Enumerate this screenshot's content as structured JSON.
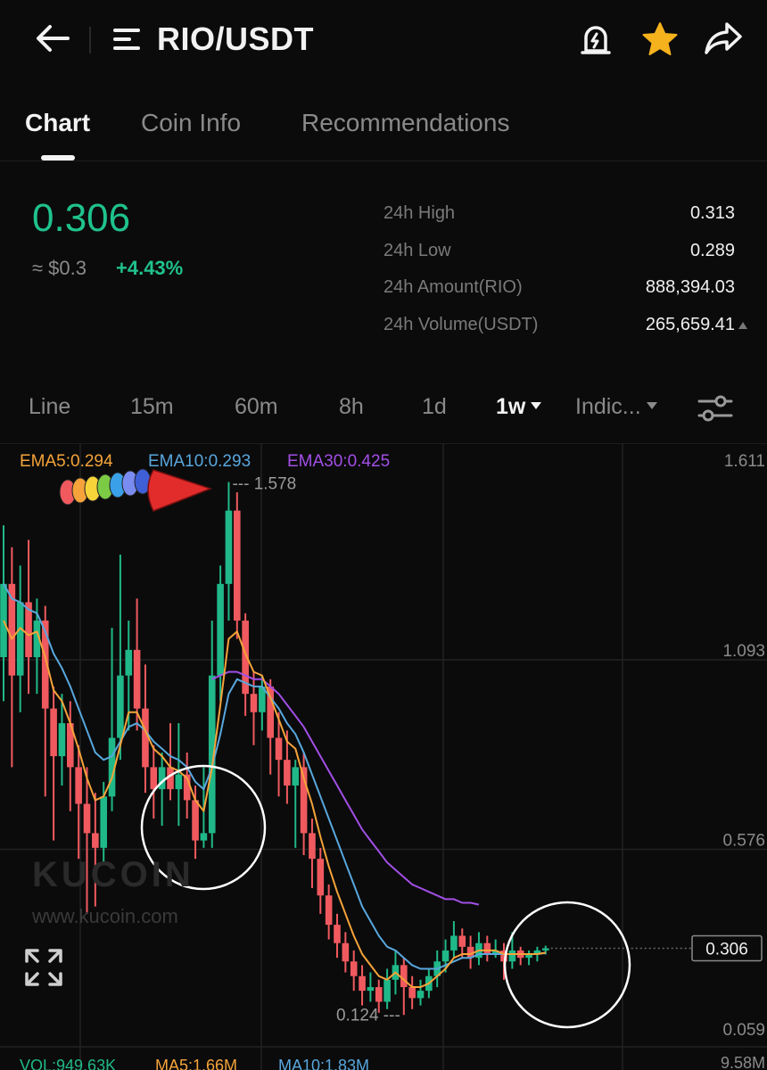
{
  "header": {
    "title": "RIO/USDT"
  },
  "tabs": [
    {
      "label": "Chart",
      "active": true
    },
    {
      "label": "Coin Info",
      "active": false
    },
    {
      "label": "Recommendations",
      "active": false
    }
  ],
  "ticker": {
    "price": "0.306",
    "fiat": "≈ $0.3",
    "change": "+4.43%",
    "stats": [
      {
        "label": "24h High",
        "value": "0.313"
      },
      {
        "label": "24h Low",
        "value": "0.289"
      },
      {
        "label": "24h Amount(RIO)",
        "value": "888,394.03"
      },
      {
        "label": "24h Volume(USDT)",
        "value": "265,659.41"
      }
    ]
  },
  "intervals": [
    "Line",
    "15m",
    "60m",
    "8h",
    "1d",
    "1w",
    "Indic..."
  ],
  "active_interval": "1w",
  "chart": {
    "legend": {
      "ema5": "EMA5:0.294",
      "ema10": "EMA10:0.293",
      "ema30": "EMA30:0.425"
    },
    "y_axis_labels": [
      "1.611",
      "1.093",
      "0.576",
      "0.059"
    ],
    "current_price_tag": "0.306",
    "high_marker": "--- 1.578",
    "low_marker": "0.124 ---",
    "watermark": "KUCOIN",
    "watermark_url": "www.kucoin.com",
    "volume_axis_label": "9.58M",
    "volume_legend": {
      "vol": "VOL:949.63K",
      "ma5": "MA5:1.66M",
      "ma10": "MA10:1.83M"
    }
  },
  "colors": {
    "up": "#20b888",
    "down": "#f05a5f",
    "ema5": "#f5a33a",
    "ema10": "#58a7dd",
    "ema30": "#a24fe6",
    "accent_star": "#f5b21d"
  },
  "chart_data": {
    "type": "candlestick",
    "interval": "1w",
    "ylim": [
      0.059,
      1.611
    ],
    "y_ticks": [
      1.611,
      1.093,
      0.576,
      0.059
    ],
    "candles": [
      {
        "o": 1.1,
        "c": 1.3,
        "h": 1.46,
        "l": 0.98
      },
      {
        "o": 1.3,
        "c": 1.05,
        "h": 1.4,
        "l": 0.8
      },
      {
        "o": 1.05,
        "c": 1.25,
        "h": 1.35,
        "l": 0.95
      },
      {
        "o": 1.25,
        "c": 1.1,
        "h": 1.42,
        "l": 1.0
      },
      {
        "o": 1.1,
        "c": 1.2,
        "h": 1.26,
        "l": 1.0
      },
      {
        "o": 1.2,
        "c": 0.96,
        "h": 1.24,
        "l": 0.72
      },
      {
        "o": 0.96,
        "c": 0.83,
        "h": 1.02,
        "l": 0.6
      },
      {
        "o": 0.83,
        "c": 0.92,
        "h": 1.0,
        "l": 0.75
      },
      {
        "o": 0.92,
        "c": 0.8,
        "h": 0.98,
        "l": 0.68
      },
      {
        "o": 0.8,
        "c": 0.7,
        "h": 0.86,
        "l": 0.55
      },
      {
        "o": 0.7,
        "c": 0.62,
        "h": 0.8,
        "l": 0.4
      },
      {
        "o": 0.62,
        "c": 0.58,
        "h": 0.73,
        "l": 0.42
      },
      {
        "o": 0.58,
        "c": 0.72,
        "h": 0.76,
        "l": 0.54
      },
      {
        "o": 0.72,
        "c": 0.88,
        "h": 1.18,
        "l": 0.68
      },
      {
        "o": 0.88,
        "c": 1.05,
        "h": 1.38,
        "l": 0.82
      },
      {
        "o": 1.05,
        "c": 1.12,
        "h": 1.2,
        "l": 0.9
      },
      {
        "o": 1.12,
        "c": 0.96,
        "h": 1.26,
        "l": 0.9
      },
      {
        "o": 0.96,
        "c": 0.8,
        "h": 1.08,
        "l": 0.73
      },
      {
        "o": 0.8,
        "c": 0.74,
        "h": 0.86,
        "l": 0.66
      },
      {
        "o": 0.74,
        "c": 0.8,
        "h": 0.84,
        "l": 0.64
      },
      {
        "o": 0.8,
        "c": 0.74,
        "h": 0.92,
        "l": 0.71
      },
      {
        "o": 0.74,
        "c": 0.78,
        "h": 0.92,
        "l": 0.64
      },
      {
        "o": 0.78,
        "c": 0.71,
        "h": 0.84,
        "l": 0.66
      },
      {
        "o": 0.71,
        "c": 0.6,
        "h": 0.75,
        "l": 0.55
      },
      {
        "o": 0.6,
        "c": 0.62,
        "h": 0.8,
        "l": 0.58
      },
      {
        "o": 0.62,
        "c": 1.05,
        "h": 1.2,
        "l": 0.58
      },
      {
        "o": 1.05,
        "c": 1.3,
        "h": 1.35,
        "l": 0.98
      },
      {
        "o": 1.3,
        "c": 1.5,
        "h": 1.578,
        "l": 1.2
      },
      {
        "o": 1.5,
        "c": 1.2,
        "h": 1.55,
        "l": 1.15
      },
      {
        "o": 1.2,
        "c": 1.0,
        "h": 1.22,
        "l": 0.94
      },
      {
        "o": 1.0,
        "c": 0.95,
        "h": 1.06,
        "l": 0.86
      },
      {
        "o": 0.95,
        "c": 1.02,
        "h": 1.05,
        "l": 0.9
      },
      {
        "o": 1.02,
        "c": 0.88,
        "h": 1.04,
        "l": 0.78
      },
      {
        "o": 0.88,
        "c": 0.82,
        "h": 0.95,
        "l": 0.72
      },
      {
        "o": 0.82,
        "c": 0.75,
        "h": 0.9,
        "l": 0.7
      },
      {
        "o": 0.75,
        "c": 0.8,
        "h": 0.82,
        "l": 0.58
      },
      {
        "o": 0.8,
        "c": 0.62,
        "h": 0.84,
        "l": 0.56
      },
      {
        "o": 0.62,
        "c": 0.55,
        "h": 0.66,
        "l": 0.47
      },
      {
        "o": 0.55,
        "c": 0.45,
        "h": 0.58,
        "l": 0.4
      },
      {
        "o": 0.45,
        "c": 0.37,
        "h": 0.48,
        "l": 0.33
      },
      {
        "o": 0.37,
        "c": 0.32,
        "h": 0.4,
        "l": 0.28
      },
      {
        "o": 0.32,
        "c": 0.27,
        "h": 0.35,
        "l": 0.24
      },
      {
        "o": 0.27,
        "c": 0.23,
        "h": 0.3,
        "l": 0.19
      },
      {
        "o": 0.23,
        "c": 0.19,
        "h": 0.26,
        "l": 0.15
      },
      {
        "o": 0.19,
        "c": 0.2,
        "h": 0.24,
        "l": 0.16
      },
      {
        "o": 0.2,
        "c": 0.16,
        "h": 0.22,
        "l": 0.13
      },
      {
        "o": 0.16,
        "c": 0.22,
        "h": 0.25,
        "l": 0.14
      },
      {
        "o": 0.22,
        "c": 0.26,
        "h": 0.3,
        "l": 0.18
      },
      {
        "o": 0.26,
        "c": 0.2,
        "h": 0.28,
        "l": 0.124
      },
      {
        "o": 0.2,
        "c": 0.17,
        "h": 0.23,
        "l": 0.14
      },
      {
        "o": 0.17,
        "c": 0.19,
        "h": 0.22,
        "l": 0.15
      },
      {
        "o": 0.19,
        "c": 0.23,
        "h": 0.25,
        "l": 0.17
      },
      {
        "o": 0.23,
        "c": 0.27,
        "h": 0.3,
        "l": 0.2
      },
      {
        "o": 0.27,
        "c": 0.3,
        "h": 0.33,
        "l": 0.24
      },
      {
        "o": 0.3,
        "c": 0.34,
        "h": 0.38,
        "l": 0.28
      },
      {
        "o": 0.34,
        "c": 0.31,
        "h": 0.36,
        "l": 0.28
      },
      {
        "o": 0.31,
        "c": 0.28,
        "h": 0.34,
        "l": 0.25
      },
      {
        "o": 0.28,
        "c": 0.32,
        "h": 0.35,
        "l": 0.26
      },
      {
        "o": 0.32,
        "c": 0.29,
        "h": 0.34,
        "l": 0.27
      },
      {
        "o": 0.29,
        "c": 0.3,
        "h": 0.33,
        "l": 0.28
      },
      {
        "o": 0.3,
        "c": 0.27,
        "h": 0.32,
        "l": 0.22
      },
      {
        "o": 0.27,
        "c": 0.3,
        "h": 0.35,
        "l": 0.25
      },
      {
        "o": 0.3,
        "c": 0.28,
        "h": 0.31,
        "l": 0.26
      },
      {
        "o": 0.28,
        "c": 0.29,
        "h": 0.3,
        "l": 0.26
      },
      {
        "o": 0.29,
        "c": 0.3,
        "h": 0.31,
        "l": 0.27
      },
      {
        "o": 0.3,
        "c": 0.306,
        "h": 0.313,
        "l": 0.289
      }
    ],
    "ema5": [
      1.2,
      1.15,
      1.18,
      1.16,
      1.17,
      1.1,
      1.01,
      0.98,
      0.92,
      0.85,
      0.77,
      0.71,
      0.72,
      0.77,
      0.86,
      0.95,
      0.95,
      0.9,
      0.85,
      0.83,
      0.8,
      0.79,
      0.77,
      0.71,
      0.68,
      0.8,
      0.97,
      1.15,
      1.17,
      1.11,
      1.06,
      1.05,
      0.99,
      0.93,
      0.87,
      0.85,
      0.77,
      0.7,
      0.61,
      0.53,
      0.46,
      0.4,
      0.34,
      0.29,
      0.26,
      0.23,
      0.22,
      0.24,
      0.22,
      0.2,
      0.2,
      0.21,
      0.23,
      0.25,
      0.28,
      0.29,
      0.29,
      0.3,
      0.3,
      0.3,
      0.29,
      0.29,
      0.29,
      0.29,
      0.29,
      0.294
    ],
    "ema10": [
      1.3,
      1.26,
      1.25,
      1.23,
      1.22,
      1.17,
      1.11,
      1.07,
      1.02,
      0.96,
      0.9,
      0.84,
      0.82,
      0.83,
      0.87,
      0.91,
      0.92,
      0.9,
      0.87,
      0.85,
      0.83,
      0.82,
      0.8,
      0.76,
      0.74,
      0.8,
      0.89,
      1.0,
      1.04,
      1.03,
      1.02,
      1.02,
      0.99,
      0.96,
      0.92,
      0.89,
      0.84,
      0.78,
      0.72,
      0.66,
      0.6,
      0.54,
      0.48,
      0.42,
      0.38,
      0.34,
      0.31,
      0.3,
      0.28,
      0.26,
      0.25,
      0.25,
      0.25,
      0.26,
      0.27,
      0.28,
      0.28,
      0.29,
      0.29,
      0.29,
      0.29,
      0.29,
      0.29,
      0.29,
      0.29,
      0.293
    ],
    "ema30": [
      null,
      null,
      null,
      null,
      null,
      null,
      null,
      null,
      null,
      null,
      null,
      null,
      null,
      null,
      null,
      null,
      null,
      null,
      null,
      null,
      null,
      null,
      null,
      null,
      null,
      1.04,
      1.05,
      1.06,
      1.06,
      1.05,
      1.04,
      1.04,
      1.02,
      1.0,
      0.97,
      0.94,
      0.91,
      0.87,
      0.83,
      0.79,
      0.75,
      0.71,
      0.67,
      0.63,
      0.6,
      0.57,
      0.54,
      0.52,
      0.5,
      0.48,
      0.47,
      0.46,
      0.45,
      0.44,
      0.44,
      0.43,
      0.43,
      0.425
    ],
    "high": 1.578,
    "low": 0.124,
    "last": 0.306
  }
}
